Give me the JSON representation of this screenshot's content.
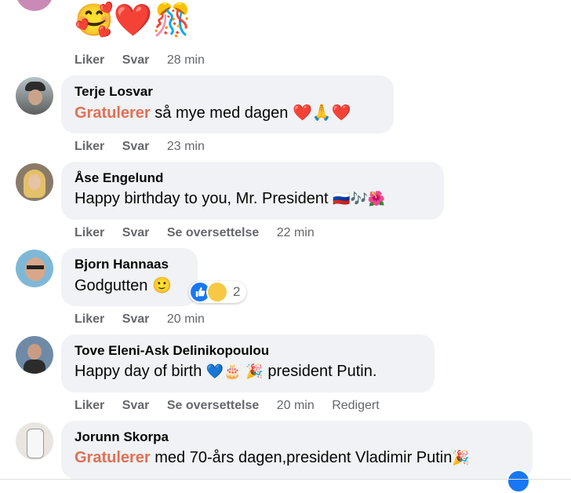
{
  "top_emojis": "🥰❤️🎊",
  "actions_labels": {
    "like": "Liker",
    "reply": "Svar",
    "translate": "Se oversettelse"
  },
  "first_time": "28 min",
  "comments": [
    {
      "author": "Terje Losvar",
      "highlight": "Gratulerer",
      "text": " så mye med dagen ",
      "emoji": "❤️🙏❤️",
      "time": "23 min"
    },
    {
      "author": "Åse Engelund",
      "highlight": "",
      "text": "Happy birthday to you, Mr. President ",
      "emoji": "🇷🇺🎶🌺",
      "time": "22 min"
    },
    {
      "author": "Bjorn Hannaas",
      "highlight": "",
      "text": "Godgutten ",
      "emoji": "🙂",
      "time": "20 min",
      "reaction_count": "2"
    },
    {
      "author": "Tove Eleni-Ask Delinikopoulou",
      "highlight": "",
      "text": "Happy day of birth ",
      "emoji": "💙🎂 🎉",
      "text2": " president Putin.",
      "time": "20 min",
      "edited": "Redigert"
    },
    {
      "author": "Jorunn Skorpa",
      "highlight": "Gratulerer",
      "text": " med 70-års dagen,president Vladimir Putin",
      "emoji": "🎉"
    }
  ],
  "colors": {
    "bubble": "#f0f2f5",
    "meta": "#65676b",
    "highlight": "#e17055",
    "like_blue": "#1877f2"
  }
}
